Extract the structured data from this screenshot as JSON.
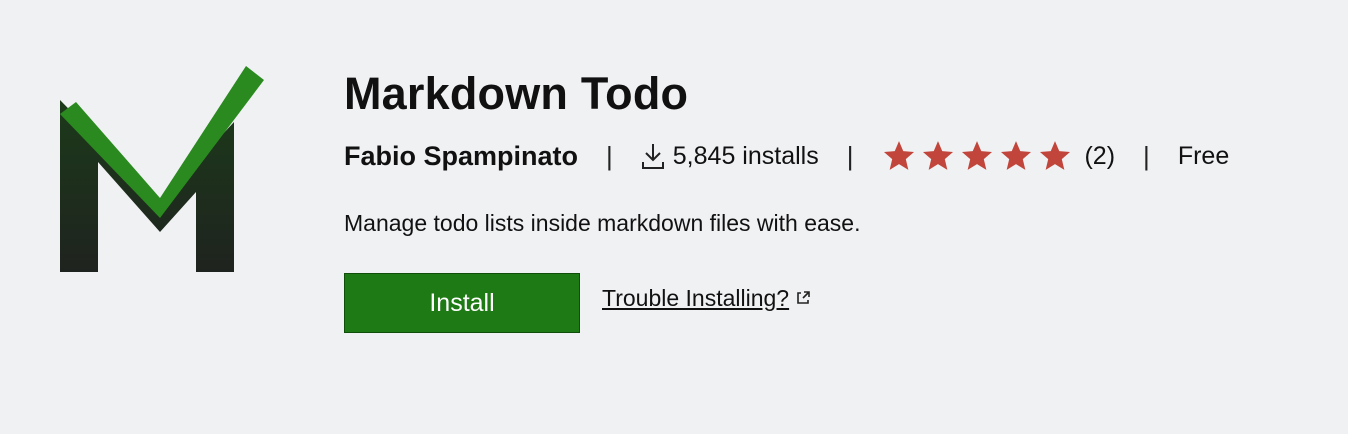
{
  "extension": {
    "title": "Markdown Todo",
    "publisher": "Fabio Spampinato",
    "installs_label": "5,845 installs",
    "rating": 5,
    "rating_count": "(2)",
    "price": "Free",
    "description": "Manage todo lists inside markdown files with ease."
  },
  "separators": [
    "|",
    "|",
    "|"
  ],
  "actions": {
    "install_label": "Install",
    "trouble_link": "Trouble Installing?"
  },
  "icons": {
    "logo": "markdown-todo-logo",
    "download": "download-icon",
    "star": "star-icon",
    "external": "external-link-icon"
  },
  "colors": {
    "background": "#f0f1f3",
    "install_button": "#1e7a14",
    "star": "#c1453a",
    "logo_green": "#2a8a1f",
    "logo_dark": "#1f2a1e"
  }
}
